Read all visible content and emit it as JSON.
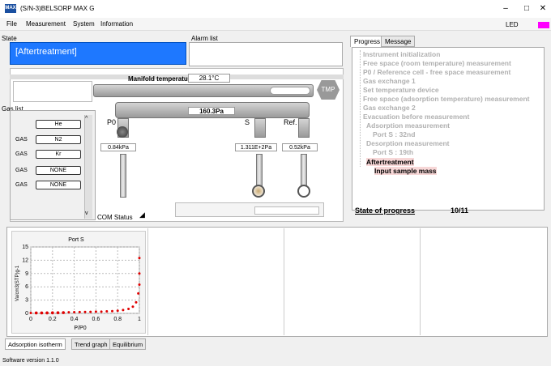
{
  "window": {
    "title": "(S/N-3)BELSORP MAX G",
    "icon_text": "MAX",
    "minimize": "–",
    "maximize": "□",
    "close": "✕"
  },
  "menu": [
    "File",
    "Measurement",
    "System",
    "Information"
  ],
  "led": {
    "label": "LED",
    "color": "#ff00ff"
  },
  "state": {
    "label": "State",
    "value": "[Aftertreatment]"
  },
  "alarm": {
    "label": "Alarm list"
  },
  "manifold": {
    "label": "Manifold temperature",
    "value": "28.1°C",
    "pressure": "160.3Pa",
    "tmp_label": "TMP"
  },
  "ports": [
    {
      "name": "P0",
      "value": "0.84kPa"
    },
    {
      "name": "S",
      "value": "1.311E+2Pa"
    },
    {
      "name": "Ref.",
      "value": "0.52kPa"
    }
  ],
  "gas_list": {
    "label": "Gas list",
    "items": [
      {
        "tag": "",
        "name": "He"
      },
      {
        "tag": "GAS",
        "name": "N2"
      },
      {
        "tag": "GAS",
        "name": "Kr"
      },
      {
        "tag": "GAS",
        "name": "NONE"
      },
      {
        "tag": "GAS",
        "name": "NONE"
      }
    ]
  },
  "com_status": "COM Status",
  "progress": {
    "tabs": [
      "Progress",
      "Message"
    ],
    "steps": [
      "Instrument initialization",
      "Free space (room temperature) measurement",
      "P0 / Reference cell - free space measurement",
      "Gas exchange 1",
      "Set temperature device",
      "Free space (adsorption temperature) measurement",
      "Gas exchange 2",
      "Evacuation before measurement",
      "Adsorption measurement",
      "Port S : 32nd",
      "Desorption measurement",
      "Port S : 19th",
      "Aftertreatment",
      "Input sample mass"
    ],
    "state_label": "State of progress",
    "state_value": "10/11"
  },
  "chart_data": {
    "type": "scatter",
    "title": "Port S",
    "xlabel": "P/P0",
    "ylabel": "Va/cm3(STP)g-1",
    "xlim": [
      0,
      1
    ],
    "ylim": [
      0,
      15
    ],
    "xticks": [
      "0",
      "0.2",
      "0.4",
      "0.6",
      "0.8",
      "1"
    ],
    "yticks": [
      "0",
      "3",
      "6",
      "9",
      "12",
      "15"
    ],
    "series": [
      {
        "values": [
          [
            0.0,
            0.1
          ],
          [
            0.05,
            0.1
          ],
          [
            0.1,
            0.12
          ],
          [
            0.15,
            0.15
          ],
          [
            0.2,
            0.18
          ],
          [
            0.25,
            0.2
          ],
          [
            0.3,
            0.22
          ],
          [
            0.35,
            0.25
          ],
          [
            0.4,
            0.27
          ],
          [
            0.45,
            0.3
          ],
          [
            0.5,
            0.32
          ],
          [
            0.55,
            0.35
          ],
          [
            0.6,
            0.38
          ],
          [
            0.65,
            0.4
          ],
          [
            0.7,
            0.45
          ],
          [
            0.75,
            0.5
          ],
          [
            0.8,
            0.6
          ],
          [
            0.85,
            0.75
          ],
          [
            0.9,
            1.0
          ],
          [
            0.94,
            1.5
          ],
          [
            0.97,
            2.5
          ],
          [
            0.99,
            4.5
          ],
          [
            1.0,
            6.5
          ],
          [
            1.0,
            9.0
          ],
          [
            1.0,
            12.5
          ]
        ]
      },
      {
        "values": [
          [
            0.05,
            0.1
          ],
          [
            0.1,
            0.1
          ],
          [
            0.15,
            0.1
          ],
          [
            0.2,
            0.12
          ],
          [
            0.25,
            0.13
          ],
          [
            0.3,
            0.15
          ]
        ]
      }
    ]
  },
  "bottom_tabs": [
    "Adsorption isotherm",
    "Trend graph",
    "Equilibrium"
  ],
  "status": "Software version 1.1.0"
}
